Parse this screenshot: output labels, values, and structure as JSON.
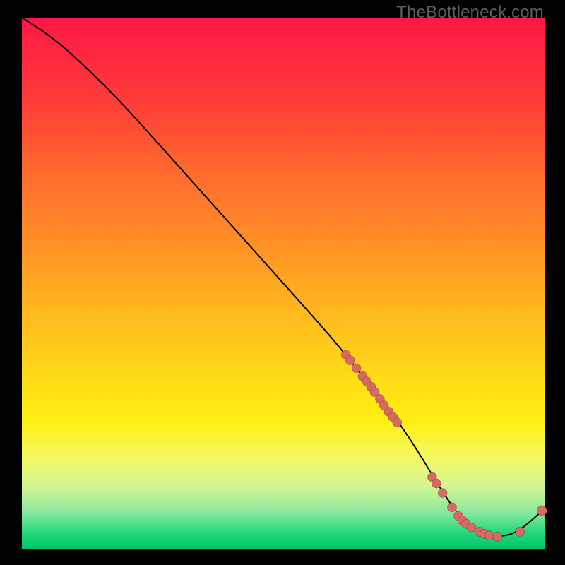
{
  "watermark": "TheBottleneck.com",
  "colors": {
    "dot": "#d96a63",
    "line": "#000000",
    "background": "#000000"
  },
  "chart_data": {
    "type": "line",
    "title": "",
    "xlabel": "",
    "ylabel": "",
    "xlim": [
      0,
      100
    ],
    "ylim": [
      0,
      100
    ],
    "grid": false,
    "legend": false,
    "series": [
      {
        "name": "curve",
        "kind": "line",
        "x": [
          0,
          4,
          8,
          14,
          20,
          30,
          40,
          50,
          60,
          68,
          72,
          76,
          80,
          83,
          86,
          89,
          92,
          95,
          100
        ],
        "y": [
          100,
          97.5,
          94.5,
          89,
          83,
          72,
          61,
          50,
          39,
          29,
          24,
          18,
          11.5,
          7,
          4,
          2.5,
          2.3,
          3.2,
          7.5
        ]
      },
      {
        "name": "upper-segment-dots",
        "kind": "scatter",
        "x": [
          62.0,
          62.8,
          64.0,
          65.2,
          66.0,
          66.8,
          67.5,
          68.5,
          69.3,
          70.2,
          71.0,
          71.8
        ],
        "y": [
          36.5,
          35.5,
          34.0,
          32.5,
          31.5,
          30.5,
          29.5,
          28.2,
          27.0,
          25.8,
          24.8,
          23.8
        ]
      },
      {
        "name": "lower-cluster-dots",
        "kind": "scatter",
        "x": [
          78.5,
          79.3,
          80.5,
          82.3,
          83.5,
          84.3,
          85.0,
          86.0,
          87.5,
          88.5,
          89.5,
          91.0,
          95.3
        ],
        "y": [
          13.5,
          12.3,
          10.5,
          7.8,
          6.2,
          5.3,
          4.7,
          4.0,
          3.2,
          2.8,
          2.5,
          2.3,
          3.2
        ]
      },
      {
        "name": "top-right-dot",
        "kind": "scatter",
        "x": [
          99.5
        ],
        "y": [
          7.2
        ]
      }
    ]
  }
}
